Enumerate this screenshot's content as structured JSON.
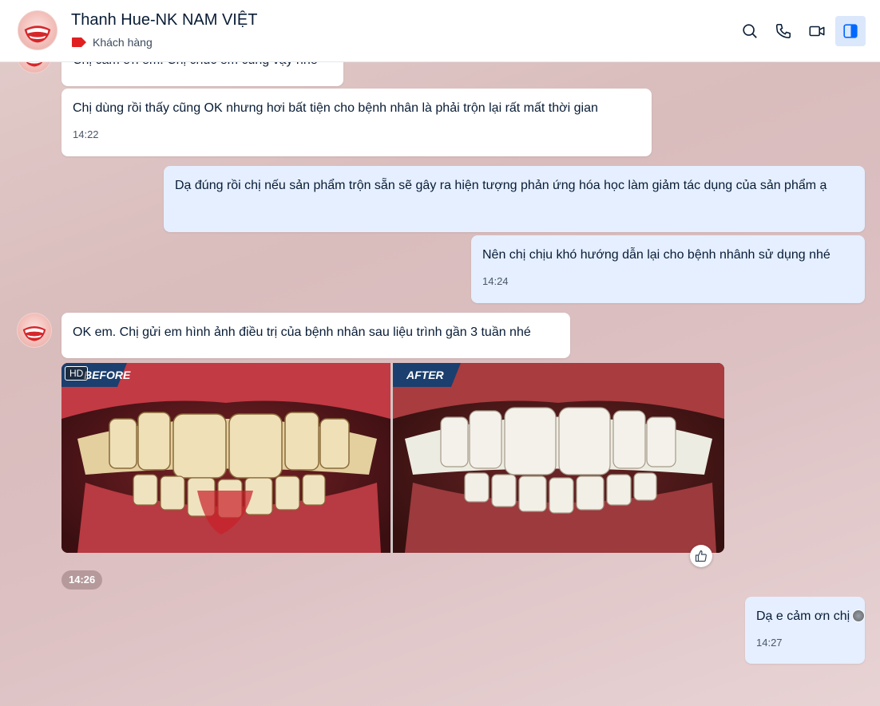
{
  "header": {
    "title": "Thanh Hue-NK NAM VIỆT",
    "tag_label": "Khách hàng",
    "tag_color": "#e02020",
    "actions": [
      {
        "name": "search-icon"
      },
      {
        "name": "phone-icon"
      },
      {
        "name": "video-call-icon"
      },
      {
        "name": "sidebar-toggle-icon",
        "active": true
      }
    ]
  },
  "messages": {
    "m0": {
      "text": "Chị cảm ơn em. Chị chúc em cũng vậy nhé"
    },
    "m1": {
      "text": "Chị dùng rồi thấy cũng OK nhưng hơi bất tiện cho bệnh nhân là phải trộn lại rất mất thời gian",
      "time": "14:22"
    },
    "m2": {
      "text": "Dạ đúng rồi chị nếu sản phẩm trộn sẵn sẽ gây ra hiện tượng phản ứng hóa học làm giảm tác dụng của sản phẩm ạ"
    },
    "m3": {
      "text": "Nên chị chịu khó hướng dẫn lại cho bệnh nhânh sử dụng nhé",
      "time": "14:24"
    },
    "m4": {
      "text": "OK em. Chị gửi em hình ảnh điều trị của bệnh nhân sau liệu trình gần 3 tuần nhé"
    },
    "photo": {
      "badge": "HD",
      "before_label": "BEFORE",
      "after_label": "AFTER",
      "time": "14:26"
    },
    "m5": {
      "text": "Dạ e cảm ơn chị",
      "time": "14:27"
    }
  },
  "colors": {
    "incoming_bubble": "#ffffff",
    "outgoing_bubble": "#e5efff",
    "accent": "#0068ff"
  }
}
